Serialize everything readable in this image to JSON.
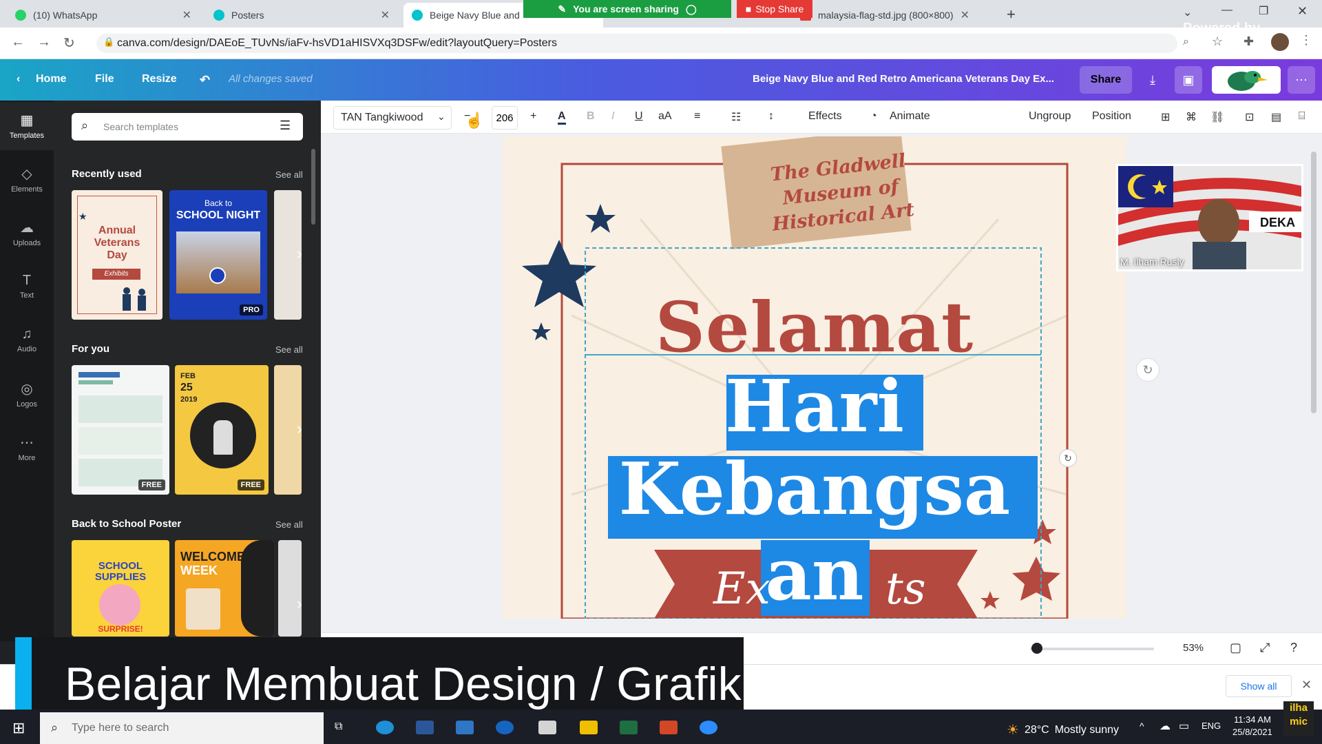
{
  "browser": {
    "tabs": [
      {
        "label": "(10) WhatsApp",
        "fav": "#25d366"
      },
      {
        "label": "Posters",
        "fav": "#00c4cc"
      },
      {
        "label": "Beige Navy Blue and",
        "fav": "#00c4cc"
      },
      {
        "label": "malaysia-flag-std.jpg (800×800)",
        "fav": "#e53935"
      }
    ],
    "screen_share_text": "You are screen sharing",
    "stop_share_label": "Stop Share",
    "url": "canva.com/design/DAEoE_TUvNs/iaFv-hsVD1aHISVXq3DSFw/edit?layoutQuery=Posters",
    "powered_by": "Powered by"
  },
  "canva_header": {
    "home": "Home",
    "file": "File",
    "resize": "Resize",
    "saved_status": "All changes saved",
    "design_title": "Beige Navy Blue and Red Retro Americana Veterans Day Ex...",
    "share": "Share"
  },
  "rail": [
    {
      "label": "Templates",
      "icon": "templates-icon",
      "glyph": "▦"
    },
    {
      "label": "Elements",
      "icon": "elements-icon",
      "glyph": "◇"
    },
    {
      "label": "Uploads",
      "icon": "upload-icon",
      "glyph": "☁"
    },
    {
      "label": "Text",
      "icon": "text-icon",
      "glyph": "T"
    },
    {
      "label": "Audio",
      "icon": "audio-icon",
      "glyph": "♫"
    },
    {
      "label": "Logos",
      "icon": "logos-icon",
      "glyph": "◎"
    },
    {
      "label": "More",
      "icon": "more-icon",
      "glyph": "⋯"
    }
  ],
  "panel": {
    "search_placeholder": "Search templates",
    "sections": [
      {
        "title": "Recently used",
        "see_all": "See all"
      },
      {
        "title": "For you",
        "see_all": "See all"
      },
      {
        "title": "Back to School Poster",
        "see_all": "See all"
      }
    ],
    "thumbs": {
      "veterans": {
        "line1": "Annual",
        "line2": "Veterans",
        "line3": "Day",
        "tag": "Exhibits"
      },
      "school_night": {
        "line1": "Back to",
        "line2": "SCHOOL NIGHT",
        "badge": "PRO"
      },
      "for_you_1": {
        "badge": "FREE"
      },
      "for_you_2": {
        "month": "FEB",
        "day": "25",
        "year": "2019",
        "badge": "FREE"
      },
      "supplies": {
        "line1": "SCHOOL",
        "line2": "SUPPLIES",
        "line3": "SURPRISE!"
      },
      "welcome": {
        "line1": "WELCOME",
        "line2": "WEEK"
      }
    }
  },
  "toolbar": {
    "font": "TAN Tangkiwood",
    "font_size": "206",
    "effects": "Effects",
    "animate": "Animate",
    "ungroup": "Ungroup",
    "position": "Position"
  },
  "poster": {
    "museum": [
      "The Gladwell",
      "Museum of",
      "Historical Art"
    ],
    "line1": "Selamat",
    "line2": "Hari",
    "line3": "Kebangsa",
    "line4": "an",
    "ribbon_left": "Ex",
    "ribbon_right": "ts"
  },
  "webcam": {
    "name": "M. Ilham Rusly",
    "flag_text": "DEKA"
  },
  "bottom": {
    "zoom": "53%",
    "zoom_level": 0.53,
    "show_all": "Show all"
  },
  "caption": "Belajar Membuat Design / Grafik",
  "taskbar": {
    "search_placeholder": "Type here to search",
    "temperature": "28°C",
    "weather": "Mostly sunny",
    "lang": "ENG",
    "time": "11:34 AM",
    "date": "25/8/2021",
    "mic_tag_1": "ilha",
    "mic_tag_2": "mic"
  },
  "colors": {
    "canva_gradient_start": "#1aa5c6",
    "canva_gradient_end": "#7a3bdc",
    "selection_blue": "#1e88e5",
    "poster_red": "#b4493f",
    "poster_navy": "#1e3a5f",
    "poster_beige": "#f9efe2"
  }
}
